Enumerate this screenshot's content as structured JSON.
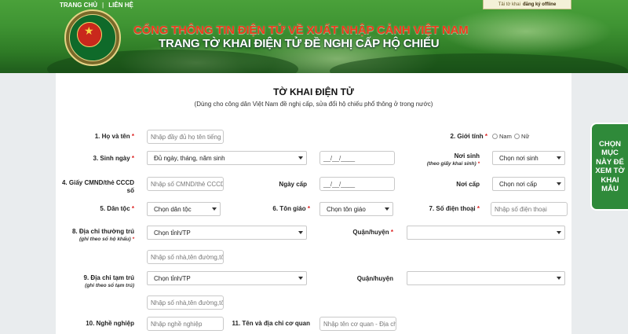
{
  "header": {
    "nav": {
      "home": "TRANG CHỦ",
      "contact": "LIÊN HỆ"
    },
    "offline": {
      "prefix": "Tải tờ khai",
      "link": "đăng ký offline"
    },
    "title_main": "CỔNG THÔNG TIN ĐIỆN TỬ VỀ XUẤT NHẬP CẢNH VIỆT NAM",
    "title_sub": "TRANG TỜ KHAI ĐIỆN TỬ ĐỀ NGHỊ CẤP HỘ CHIẾU",
    "emblem_text": "CỤC QUẢN LÝ XUẤT NHẬP CẢNH · IMMIGRATION"
  },
  "form": {
    "title": "TỜ KHAI ĐIỆN TỬ",
    "subtitle": "(Dùng cho công dân Việt Nam đề nghị cấp, sửa đổi hộ chiếu phổ thông ở trong nước)",
    "fields": {
      "name": {
        "label": "1. Họ và tên",
        "placeholder": "Nhập đầy đủ họ tên tiếng"
      },
      "gender": {
        "label": "2. Giới tính",
        "options": [
          "Nam",
          "Nữ"
        ]
      },
      "dob": {
        "label": "3. Sinh ngày",
        "select": "Đủ ngày, tháng, năm sinh",
        "date": "__/__/____"
      },
      "birthplace": {
        "label": "Nơi sinh",
        "note": "(theo giấy khai sinh)",
        "select": "Chọn nơi sinh"
      },
      "id_card": {
        "label_line1": "4. Giấy CMND/thẻ CCCD",
        "label_line2": "số",
        "placeholder": "Nhập số CMND/thẻ CCCD"
      },
      "issue_date": {
        "label": "Ngày cấp",
        "date": "__/__/____"
      },
      "issue_place": {
        "label": "Nơi cấp",
        "select": "Chọn nơi cấp"
      },
      "ethnicity": {
        "label": "5. Dân tộc",
        "select": "Chọn dân tộc"
      },
      "religion": {
        "label": "6. Tôn giáo",
        "select": "Chọn tôn giáo"
      },
      "phone": {
        "label": "7. Số điện thoại",
        "placeholder": "Nhập số điện thoại"
      },
      "permanent": {
        "label": "8. Địa chỉ thường trú",
        "note": "(ghi theo sổ hộ khẩu)",
        "select": "Chọn tỉnh/TP",
        "detail_placeholder": "Nhập số nhà,tên đường,tổ"
      },
      "district1": {
        "label": "Quận/huyện",
        "select": ""
      },
      "temporary": {
        "label": "9. Địa chỉ tạm trú",
        "note": "(ghi theo sổ tạm trú)",
        "select": "Chọn tỉnh/TP",
        "detail_placeholder": "Nhập số nhà,tên đường,tổ"
      },
      "district2": {
        "label": "Quận/huyện",
        "select": ""
      },
      "job": {
        "label": "10. Nghề nghiệp",
        "placeholder": "Nhập nghề nghiệp"
      },
      "agency": {
        "label": "11. Tên và địa chỉ cơ quan",
        "placeholder": "Nhập tên cơ quan - Địa chỉ"
      }
    },
    "required_mark": "*"
  },
  "side_tab": {
    "label": "CHỌN MỤC NÀY ĐỂ XEM TỜ KHAI MẪU"
  }
}
